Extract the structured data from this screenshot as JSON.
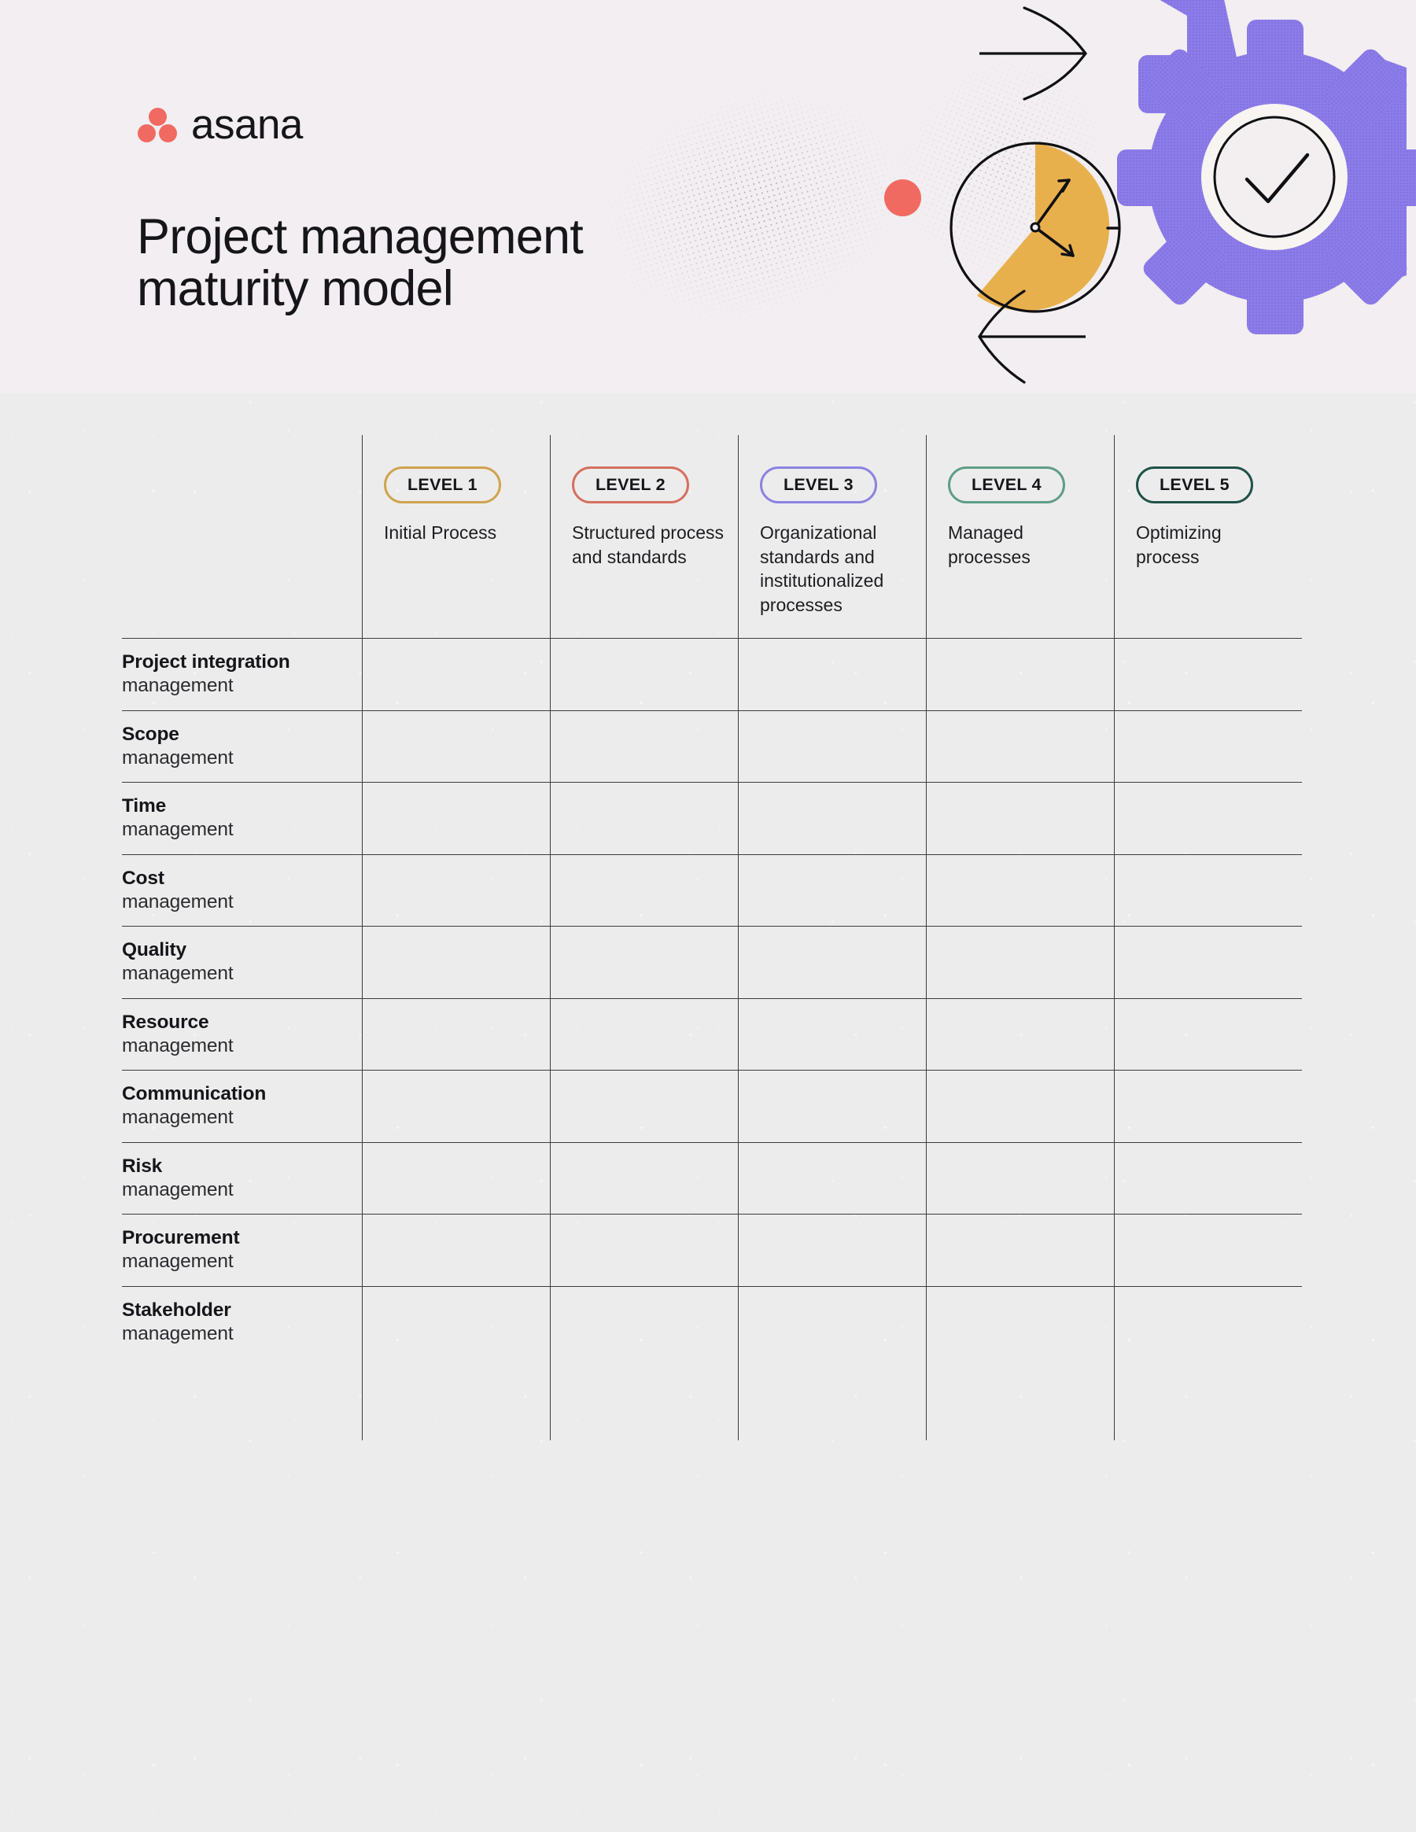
{
  "brand": {
    "name": "asana",
    "logo_icon": "asana-logo-icon",
    "logo_color": "#f06a61"
  },
  "header": {
    "title": "Project management\nmaturity model",
    "background_color": "#f2eef1"
  },
  "decor": {
    "gear_icon": "gear-icon",
    "gear_color": "#8c7ce8",
    "check_icon": "check-icon",
    "clock_icon": "clock-pie-icon",
    "clock_color": "#e8b04d",
    "arrow_right_icon": "arrow-right-icon",
    "arrow_left_icon": "arrow-left-icon",
    "dot_icon": "red-dot-icon",
    "dot_color": "#f06a61",
    "halftone_icon": "halftone-blob-icon"
  },
  "table": {
    "row_label_column_header": "",
    "levels": [
      {
        "badge": "LEVEL 1",
        "description": "Initial Process",
        "color": "#cfa34e"
      },
      {
        "badge": "LEVEL 2",
        "description": "Structured process and standards",
        "color": "#d4705f"
      },
      {
        "badge": "LEVEL 3",
        "description": "Organizational standards and institutionalized processes",
        "color": "#8c82e0"
      },
      {
        "badge": "LEVEL 4",
        "description": "Managed processes",
        "color": "#5d9e86"
      },
      {
        "badge": "LEVEL 5",
        "description": "Optimizing process",
        "color": "#1f5247"
      }
    ],
    "rows": [
      {
        "title": "Project integration",
        "subtitle": "management"
      },
      {
        "title": "Scope",
        "subtitle": "management"
      },
      {
        "title": "Time",
        "subtitle": "management"
      },
      {
        "title": "Cost",
        "subtitle": "management"
      },
      {
        "title": "Quality",
        "subtitle": "management"
      },
      {
        "title": "Resource",
        "subtitle": "management"
      },
      {
        "title": "Communication",
        "subtitle": "management"
      },
      {
        "title": "Risk",
        "subtitle": "management"
      },
      {
        "title": "Procurement",
        "subtitle": "management"
      },
      {
        "title": "Stakeholder",
        "subtitle": "management"
      }
    ]
  }
}
